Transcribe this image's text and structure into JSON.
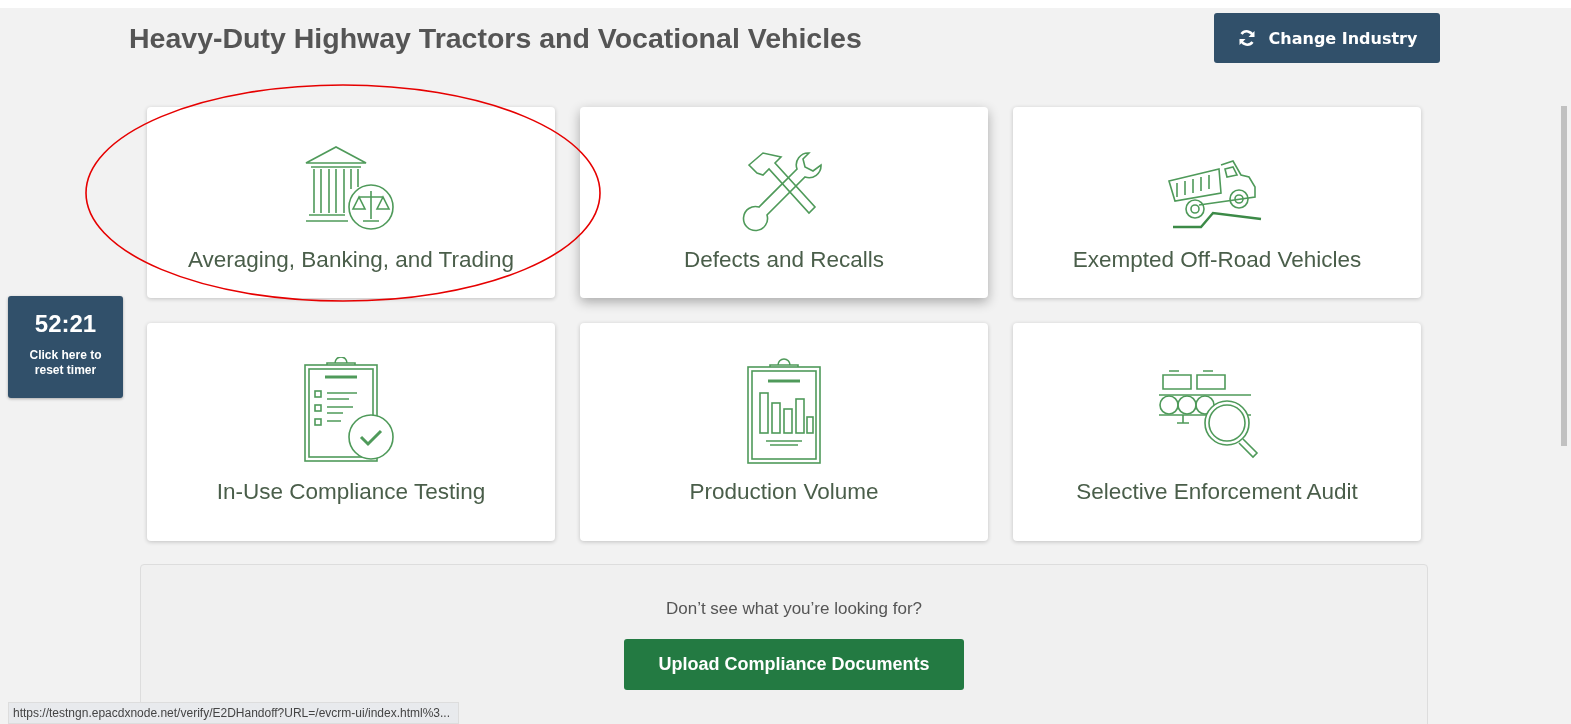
{
  "header": {
    "title": "Heavy-Duty Highway Tractors and Vocational Vehicles",
    "button": "Change Industry"
  },
  "cards": [
    {
      "kind": "bank",
      "label": "Averaging, Banking, and Trading",
      "hovered": false,
      "circled": true
    },
    {
      "kind": "tools",
      "label": "Defects and Recalls",
      "hovered": true,
      "circled": false
    },
    {
      "kind": "truck",
      "label": "Exempted Off-Road Vehicles",
      "hovered": false,
      "circled": false
    },
    {
      "kind": "checklist",
      "label": "In-Use Compliance Testing",
      "hovered": false,
      "circled": false
    },
    {
      "kind": "chart",
      "label": "Production Volume",
      "hovered": false,
      "circled": false
    },
    {
      "kind": "audit",
      "label": "Selective Enforcement Audit",
      "hovered": false,
      "circled": false
    }
  ],
  "help": {
    "text": "Don’t see what you’re looking for?",
    "button": "Upload Compliance Documents"
  },
  "timer": {
    "time": "52:21",
    "caption": "Click here to reset timer"
  },
  "status_bar": {
    "url": "https://testngn.epacdxnode.net/verify/E2DHandoff?URL=/evcrm-ui/index.html%3..."
  }
}
